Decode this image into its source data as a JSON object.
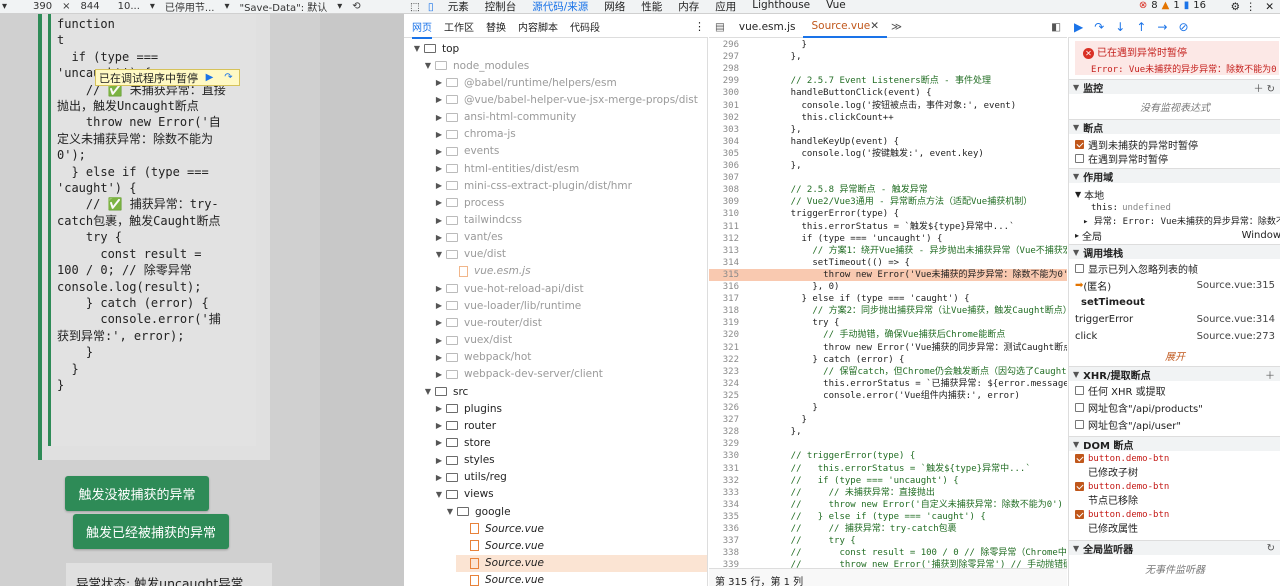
{
  "device_toolbar": {
    "width": "390",
    "times": "×",
    "height": "844",
    "zoom": "10...",
    "throttle": "已停用节...",
    "save_data": "\"Save-Data\": 默认"
  },
  "page": {
    "code_lines": [
      "function",
      "t",
      "  if (type ===",
      "'uncaught') {",
      "    // ✅ 未捕获异常：直接",
      "抛出，触发Uncaught断点",
      "    throw new Error('自",
      "定义未捕获异常：除数不能为",
      "0');",
      "  } else if (type ===",
      "'caught') {",
      "    // ✅ 捕获异常：try-",
      "catch包裹，触发Caught断点",
      "    try {",
      "      const result =",
      "100 / 0; // 除零异常",
      "",
      "console.log(result);",
      "    } catch (error) {",
      "      console.error('捕",
      "获到异常:', error);",
      "    }",
      "  }",
      "}"
    ],
    "paused_badge": "已在调试程序中暂停",
    "btn_uncaught": "触发没被捕获的异常",
    "btn_caught": "触发已经被捕获的异常",
    "status_text": "异常状态: 触发uncaught异常"
  },
  "devtools": {
    "tabs": [
      "元素",
      "控制台",
      "源代码/来源",
      "网络",
      "性能",
      "内存",
      "应用",
      "Lighthouse",
      "Vue"
    ],
    "active_tab": "源代码/来源",
    "error_count": "8",
    "warn_count": "1",
    "info_count": "16",
    "sub_tabs": [
      "网页",
      "工作区",
      "替换",
      "内容脚本",
      "代码段"
    ],
    "tree": [
      {
        "label": "top",
        "type": "frame",
        "depth": 0,
        "open": true
      },
      {
        "label": "node_modules",
        "type": "folder",
        "depth": 1,
        "open": true,
        "dim": true
      },
      {
        "label": "@babel/runtime/helpers/esm",
        "type": "folder",
        "depth": 2,
        "dim": true
      },
      {
        "label": "@vue/babel-helper-vue-jsx-merge-props/dist",
        "type": "folder",
        "depth": 2,
        "dim": true
      },
      {
        "label": "ansi-html-community",
        "type": "folder",
        "depth": 2,
        "dim": true
      },
      {
        "label": "chroma-js",
        "type": "folder",
        "depth": 2,
        "dim": true
      },
      {
        "label": "events",
        "type": "folder",
        "depth": 2,
        "dim": true
      },
      {
        "label": "html-entities/dist/esm",
        "type": "folder",
        "depth": 2,
        "dim": true
      },
      {
        "label": "mini-css-extract-plugin/dist/hmr",
        "type": "folder",
        "depth": 2,
        "dim": true
      },
      {
        "label": "process",
        "type": "folder",
        "depth": 2,
        "dim": true
      },
      {
        "label": "tailwindcss",
        "type": "folder",
        "depth": 2,
        "dim": true
      },
      {
        "label": "vant/es",
        "type": "folder",
        "depth": 2,
        "dim": true
      },
      {
        "label": "vue/dist",
        "type": "folder",
        "depth": 2,
        "open": true,
        "dim": true
      },
      {
        "label": "vue.esm.js",
        "type": "file",
        "depth": 3,
        "dim": true
      },
      {
        "label": "vue-hot-reload-api/dist",
        "type": "folder",
        "depth": 2,
        "dim": true
      },
      {
        "label": "vue-loader/lib/runtime",
        "type": "folder",
        "depth": 2,
        "dim": true
      },
      {
        "label": "vue-router/dist",
        "type": "folder",
        "depth": 2,
        "dim": true
      },
      {
        "label": "vuex/dist",
        "type": "folder",
        "depth": 2,
        "dim": true
      },
      {
        "label": "webpack/hot",
        "type": "folder",
        "depth": 2,
        "dim": true
      },
      {
        "label": "webpack-dev-server/client",
        "type": "folder",
        "depth": 2,
        "dim": true
      },
      {
        "label": "src",
        "type": "folder",
        "depth": 1,
        "open": true
      },
      {
        "label": "plugins",
        "type": "folder",
        "depth": 2
      },
      {
        "label": "router",
        "type": "folder",
        "depth": 2
      },
      {
        "label": "store",
        "type": "folder",
        "depth": 2
      },
      {
        "label": "styles",
        "type": "folder",
        "depth": 2
      },
      {
        "label": "utils/reg",
        "type": "folder",
        "depth": 2
      },
      {
        "label": "views",
        "type": "folder",
        "depth": 2,
        "open": true
      },
      {
        "label": "google",
        "type": "folder",
        "depth": 3,
        "open": true
      },
      {
        "label": "Source.vue",
        "type": "file",
        "depth": 4
      },
      {
        "label": "Source.vue",
        "type": "file",
        "depth": 4
      },
      {
        "label": "Source.vue",
        "type": "file",
        "depth": 4,
        "selected": true
      },
      {
        "label": "Source.vue",
        "type": "file",
        "depth": 4
      }
    ],
    "editor_tabs": [
      {
        "label": "vue.esm.js",
        "active": false
      },
      {
        "label": "Source.vue",
        "active": true
      }
    ],
    "code": [
      {
        "n": "296",
        "t": "      }"
      },
      {
        "n": "297",
        "t": "    },"
      },
      {
        "n": "298",
        "t": ""
      },
      {
        "n": "299",
        "t": "    // 2.5.7 Event Listeners断点 - 事件处理",
        "c": "com"
      },
      {
        "n": "300",
        "t": "    handleButtonClick(event) {"
      },
      {
        "n": "301",
        "t": "      console.log('按钮被点击，事件对象:', event)"
      },
      {
        "n": "302",
        "t": "      this.clickCount++"
      },
      {
        "n": "303",
        "t": "    },"
      },
      {
        "n": "304",
        "t": "    handleKeyUp(event) {"
      },
      {
        "n": "305",
        "t": "      console.log('按键触发:', event.key)"
      },
      {
        "n": "306",
        "t": "    },"
      },
      {
        "n": "307",
        "t": ""
      },
      {
        "n": "308",
        "t": "    // 2.5.8 异常断点 - 触发异常",
        "c": "com"
      },
      {
        "n": "309",
        "t": "    // Vue2/Vue3通用 - 异常断点方法（适配Vue捕获机制）",
        "c": "com"
      },
      {
        "n": "310",
        "t": "    triggerError(type) {"
      },
      {
        "n": "311",
        "t": "      this.errorStatus = `触发${type}异常中...`"
      },
      {
        "n": "312",
        "t": "      if (type === 'uncaught') {"
      },
      {
        "n": "313",
        "t": "        // 方案1：绕开Vue捕获 - 异步抛出未捕获异常（Vue不捕获宏任务中",
        "c": "com"
      },
      {
        "n": "314",
        "t": "        setTimeout(() => {"
      },
      {
        "n": "315",
        "t": "          throw new Error('Vue未捕获的异步异常：除数不能为0')",
        "hl": true
      },
      {
        "n": "316",
        "t": "        }, 0)"
      },
      {
        "n": "317",
        "t": "      } else if (type === 'caught') {"
      },
      {
        "n": "318",
        "t": "        // 方案2：同步抛出捕获异常（让Vue捕获，触发Caught断点）",
        "c": "com"
      },
      {
        "n": "319",
        "t": "        try {"
      },
      {
        "n": "320",
        "t": "          // 手动抛错，确保Vue捕获后Chrome能断点",
        "c": "com"
      },
      {
        "n": "321",
        "t": "          throw new Error('Vue捕获的同步异常：测试Caught断点')"
      },
      {
        "n": "322",
        "t": "        } catch (error) {"
      },
      {
        "n": "323",
        "t": "          // 保留catch，但Chrome仍会触发断点（因勾选了Caught）",
        "c": "com"
      },
      {
        "n": "324",
        "t": "          this.errorStatus = `已捕获异常: ${error.message}`"
      },
      {
        "n": "325",
        "t": "          console.error('Vue组件内捕获:', error)"
      },
      {
        "n": "326",
        "t": "        }"
      },
      {
        "n": "327",
        "t": "      }"
      },
      {
        "n": "328",
        "t": "    },"
      },
      {
        "n": "329",
        "t": ""
      },
      {
        "n": "330",
        "t": "    // triggerError(type) {",
        "c": "com"
      },
      {
        "n": "331",
        "t": "    //   this.errorStatus = `触发${type}异常中...`",
        "c": "com"
      },
      {
        "n": "332",
        "t": "    //   if (type === 'uncaught') {",
        "c": "com"
      },
      {
        "n": "333",
        "t": "    //     // 未捕获异常：直接抛出",
        "c": "com"
      },
      {
        "n": "334",
        "t": "    //     throw new Error('自定义未捕获异常：除数不能为0')",
        "c": "com"
      },
      {
        "n": "335",
        "t": "    //   } else if (type === 'caught') {",
        "c": "com"
      },
      {
        "n": "336",
        "t": "    //     // 捕获异常：try-catch包裹",
        "c": "com"
      },
      {
        "n": "337",
        "t": "    //     try {",
        "c": "com"
      },
      {
        "n": "338",
        "t": "    //       const result = 100 / 0 // 除零异常（Chrome中返回In",
        "c": "com"
      },
      {
        "n": "339",
        "t": "    //       throw new Error('捕获到除零异常') // 手动抛错确保触发",
        "c": "com"
      }
    ],
    "status_bar": "第 315 行，第 1 列",
    "pause_title": "已在遇到异常时暂停",
    "pause_detail": "Error: Vue未捕获的异步异常：除数不能为0",
    "watch_title": "监控",
    "watch_empty": "没有监视表达式",
    "breakpoints_title": "断点",
    "bp_uncaught": "遇到未捕获的异常时暂停",
    "bp_caught": "在遇到异常时暂停",
    "scope_title": "作用域",
    "scope_local": "本地",
    "scope_this_key": "this:",
    "scope_this_val": "undefined",
    "scope_exc": "▸ 异常: Error: Vue未捕获的异步异常：除数不能",
    "scope_global": "全局",
    "scope_global_val": "Window",
    "callstack_title": "调用堆栈",
    "show_ignored": "显示已列入忽略列表的帧",
    "frames": [
      {
        "name": "(匿名)",
        "loc": "Source.vue:315",
        "current": true
      },
      {
        "name": "setTimeout",
        "loc": "",
        "bold": true
      },
      {
        "name": "triggerError",
        "loc": "Source.vue:314"
      },
      {
        "name": "click",
        "loc": "Source.vue:273"
      }
    ],
    "expand": "展开",
    "xhr_title": "XHR/提取断点",
    "xhr_items": [
      "任何 XHR 或提取",
      "网址包含\"/api/products\"",
      "网址包含\"/api/user\""
    ],
    "dom_title": "DOM 断点",
    "dom_items": [
      {
        "sel": "button.demo-btn",
        "desc": "已修改子树"
      },
      {
        "sel": "button.demo-btn",
        "desc": "节点已移除"
      },
      {
        "sel": "button.demo-btn",
        "desc": "已修改属性"
      }
    ],
    "global_listeners_title": "全局监听器",
    "no_listeners": "无事件监听器"
  }
}
